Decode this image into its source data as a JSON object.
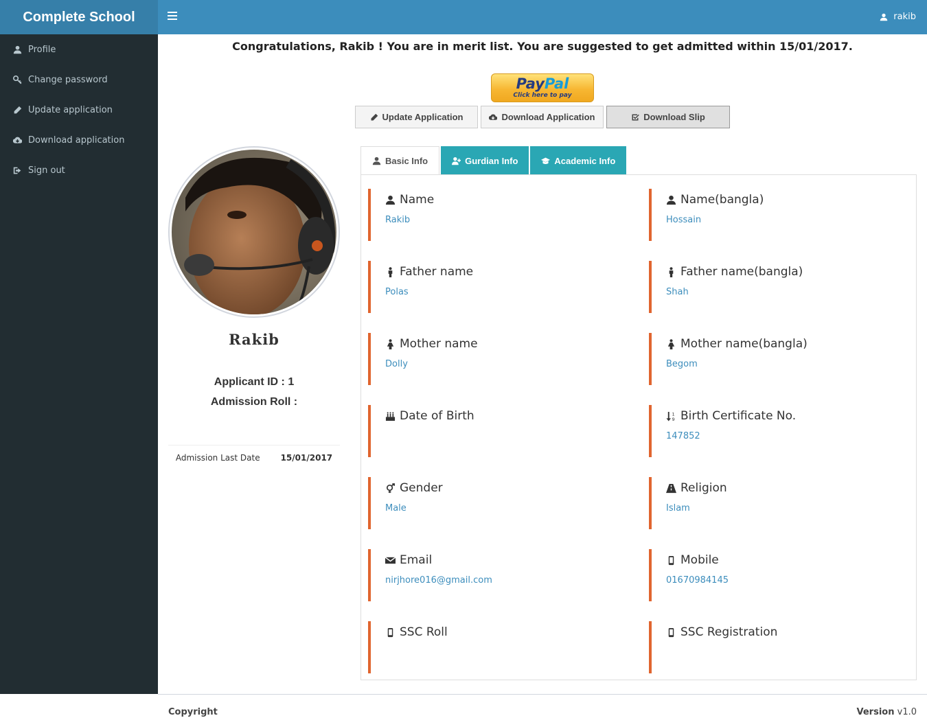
{
  "app": {
    "brand": "Complete School",
    "user": "rakib"
  },
  "sidebar": {
    "items": [
      {
        "label": "Profile",
        "icon": "user-icon"
      },
      {
        "label": "Change password",
        "icon": "key-icon"
      },
      {
        "label": "Update application",
        "icon": "pencil-icon"
      },
      {
        "label": "Download application",
        "icon": "cloud-download-icon"
      },
      {
        "label": "Sign out",
        "icon": "sign-out-icon"
      }
    ]
  },
  "main": {
    "congrats": "Congratulations, Rakib ! You are in merit list. You are suggested to get admitted within 15/01/2017.",
    "paypal": {
      "logo_a": "Pay",
      "logo_b": "Pal",
      "sub": "Click here to pay"
    },
    "buttons": {
      "update": "Update Application",
      "download": "Download Application",
      "slip": "Download Slip"
    }
  },
  "profile": {
    "name": "Rakib",
    "applicant_id": "Applicant ID : 1",
    "admission_roll": "Admission Roll :",
    "last_date_label": "Admission Last Date",
    "last_date_value": "15/01/2017"
  },
  "tabs": {
    "basic": "Basic Info",
    "guardian": "Gurdian Info",
    "academic": "Academic Info"
  },
  "fields": {
    "name": {
      "label": "Name",
      "value": "Rakib"
    },
    "name_bangla": {
      "label": "Name(bangla)",
      "value": "Hossain"
    },
    "father": {
      "label": "Father name",
      "value": "Polas"
    },
    "father_bangla": {
      "label": "Father name(bangla)",
      "value": "Shah"
    },
    "mother": {
      "label": "Mother name",
      "value": "Dolly"
    },
    "mother_bangla": {
      "label": "Mother name(bangla)",
      "value": "Begom"
    },
    "dob": {
      "label": "Date of Birth",
      "value": ""
    },
    "birth_cert": {
      "label": "Birth Certificate No.",
      "value": "147852"
    },
    "gender": {
      "label": "Gender",
      "value": "Male"
    },
    "religion": {
      "label": "Religion",
      "value": "Islam"
    },
    "email": {
      "label": "Email",
      "value": "nirjhore016@gmail.com"
    },
    "mobile": {
      "label": "Mobile",
      "value": "01670984145"
    },
    "ssc_roll": {
      "label": "SSC Roll",
      "value": ""
    },
    "ssc_reg": {
      "label": "SSC Registration",
      "value": ""
    }
  },
  "footer": {
    "copyright": "Copyright",
    "version_label": "Version",
    "version_value": "v1.0"
  },
  "colors": {
    "header": "#3c8dbc",
    "brand": "#367fa9",
    "sidebar": "#222d32",
    "accent_border": "#e0652f",
    "tab_teal": "#2aa7b4",
    "value_link": "#3c8dbc"
  }
}
